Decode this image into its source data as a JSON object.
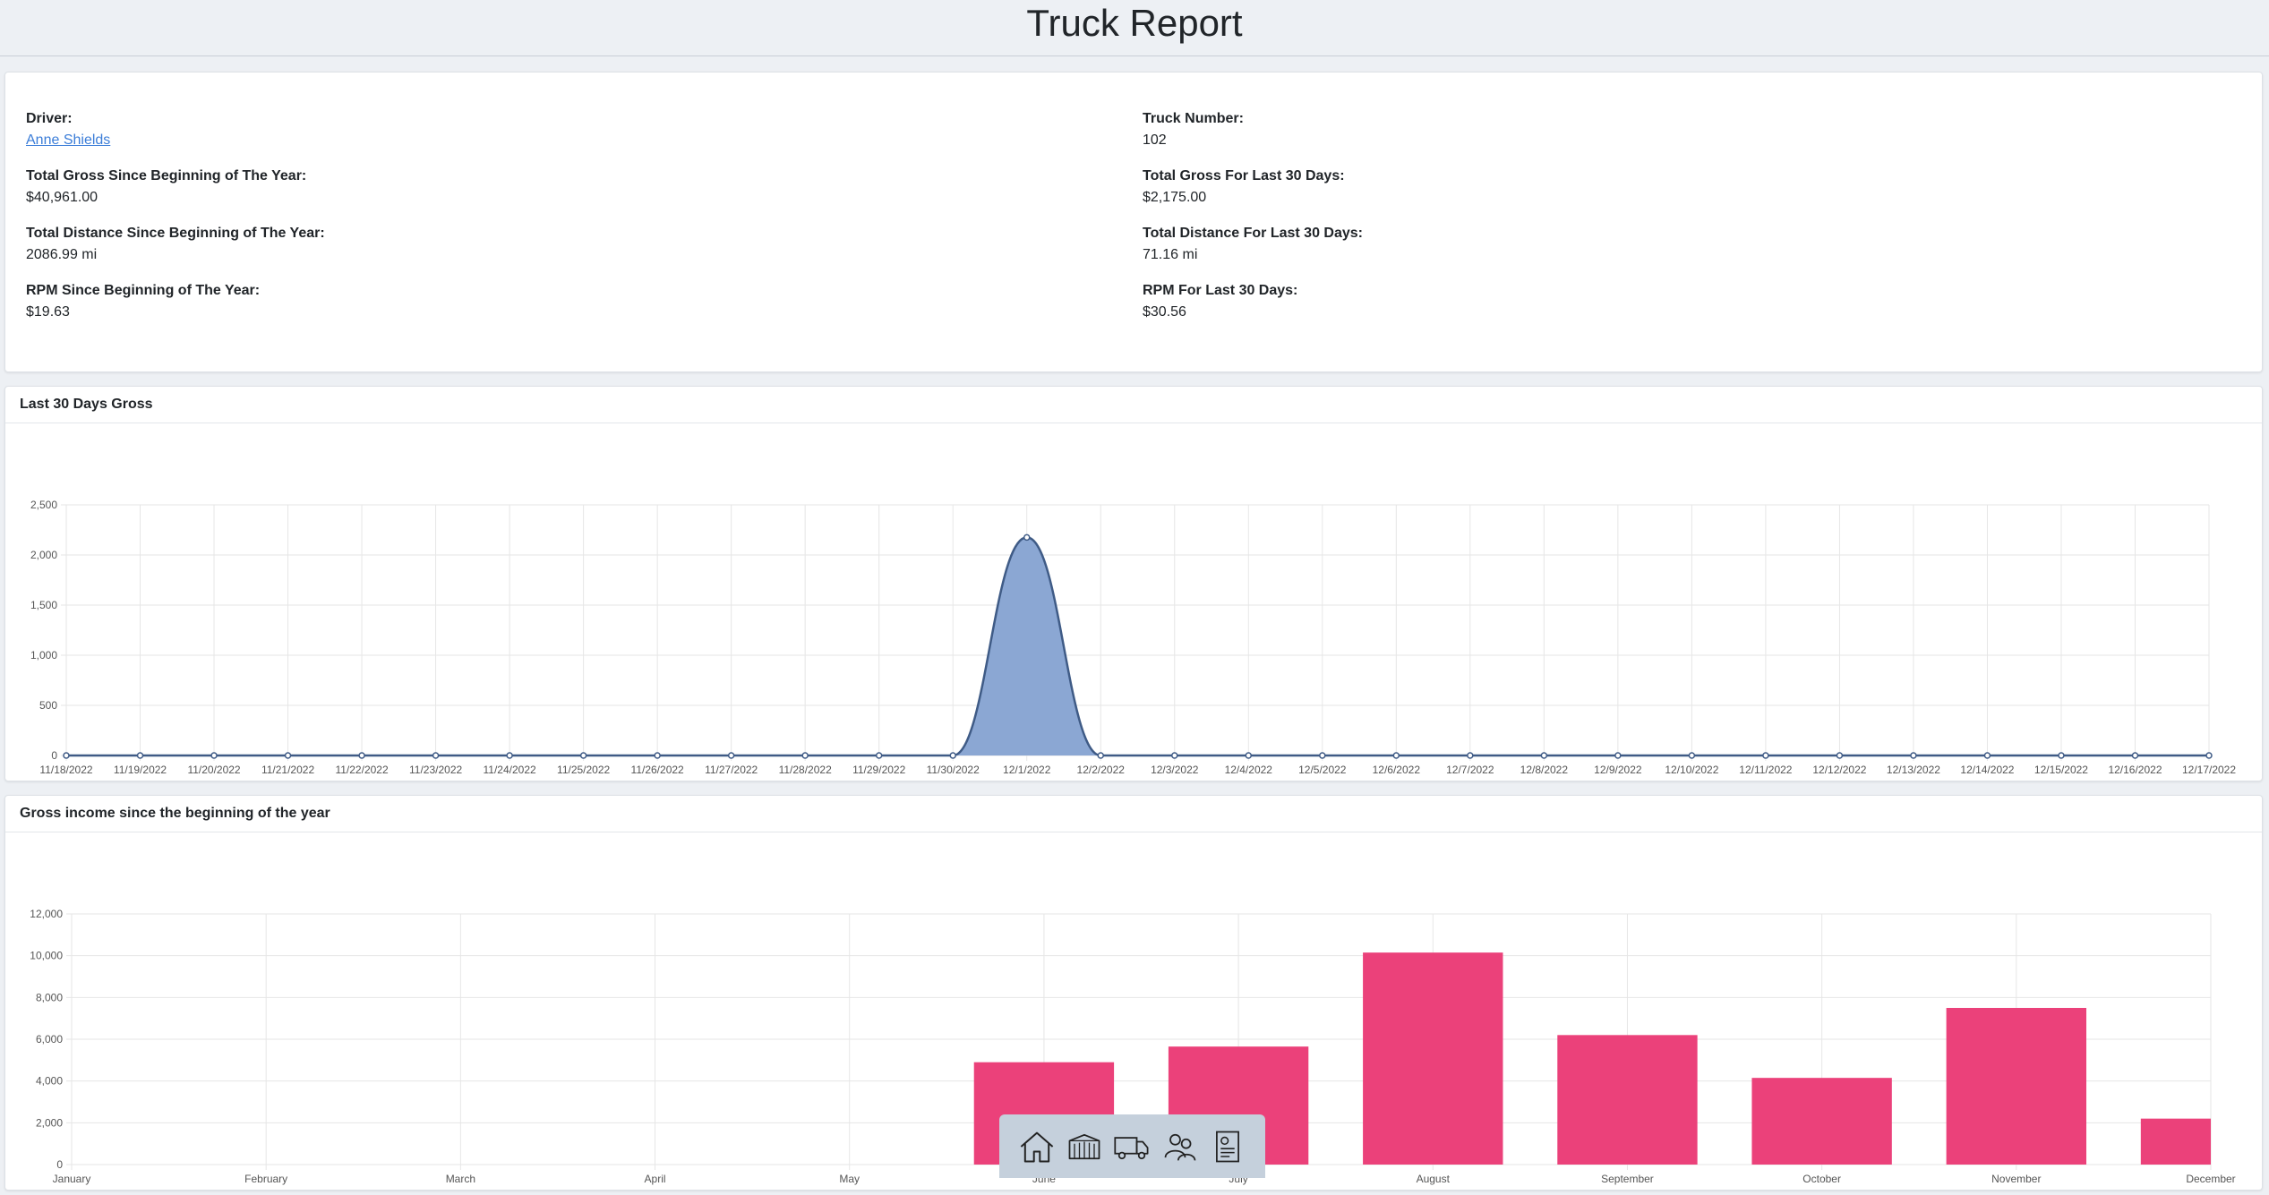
{
  "page": {
    "title": "Truck Report"
  },
  "info": {
    "left": [
      {
        "label": "Driver:",
        "value": "Anne Shields",
        "link": true
      },
      {
        "label": "Total Gross Since Beginning of The Year:",
        "value": "$40,961.00"
      },
      {
        "label": "Total Distance Since Beginning of The Year:",
        "value": "2086.99 mi"
      },
      {
        "label": "RPM Since Beginning of The Year:",
        "value": "$19.63"
      }
    ],
    "right": [
      {
        "label": "Truck Number:",
        "value": "102"
      },
      {
        "label": "Total Gross For Last 30 Days:",
        "value": "$2,175.00"
      },
      {
        "label": "Total Distance For Last 30 Days:",
        "value": "71.16 mi"
      },
      {
        "label": "RPM For Last 30 Days:",
        "value": "$30.56"
      }
    ]
  },
  "line_card": {
    "title": "Last 30 Days Gross"
  },
  "bar_card": {
    "title": "Gross income since the beginning of the year"
  },
  "colors": {
    "line_stroke": "#3f5b86",
    "line_fill": "#8ba7d3",
    "bar_fill": "#eb417a",
    "grid": "#e6e6e6"
  },
  "dock": {
    "icons": [
      "home-icon",
      "warehouse-icon",
      "truck-icon",
      "users-icon",
      "report-icon"
    ]
  },
  "chart_data": [
    {
      "type": "area",
      "title": "Last 30 Days Gross",
      "x": [
        "11/18/2022",
        "11/19/2022",
        "11/20/2022",
        "11/21/2022",
        "11/22/2022",
        "11/23/2022",
        "11/24/2022",
        "11/25/2022",
        "11/26/2022",
        "11/27/2022",
        "11/28/2022",
        "11/29/2022",
        "11/30/2022",
        "12/1/2022",
        "12/2/2022",
        "12/3/2022",
        "12/4/2022",
        "12/5/2022",
        "12/6/2022",
        "12/7/2022",
        "12/8/2022",
        "12/9/2022",
        "12/10/2022",
        "12/11/2022",
        "12/12/2022",
        "12/13/2022",
        "12/14/2022",
        "12/15/2022",
        "12/16/2022",
        "12/17/2022"
      ],
      "values": [
        0,
        0,
        0,
        0,
        0,
        0,
        0,
        0,
        0,
        0,
        0,
        0,
        0,
        2175,
        0,
        0,
        0,
        0,
        0,
        0,
        0,
        0,
        0,
        0,
        0,
        0,
        0,
        0,
        0,
        0
      ],
      "yticks": [
        "0",
        "500",
        "1,000",
        "1,500",
        "2,000",
        "2,500"
      ],
      "ylim": [
        0,
        2500
      ],
      "grid": true
    },
    {
      "type": "bar",
      "title": "Gross income since the beginning of the year",
      "categories": [
        "January",
        "February",
        "March",
        "April",
        "May",
        "June",
        "July",
        "August",
        "September",
        "October",
        "November",
        "December"
      ],
      "values": [
        0,
        0,
        0,
        0,
        0,
        4900,
        5650,
        10150,
        6200,
        4150,
        7500,
        2200
      ],
      "yticks": [
        "0",
        "2,000",
        "4,000",
        "6,000",
        "8,000",
        "10,000",
        "12,000"
      ],
      "ylim": [
        0,
        12000
      ],
      "grid": true
    }
  ]
}
